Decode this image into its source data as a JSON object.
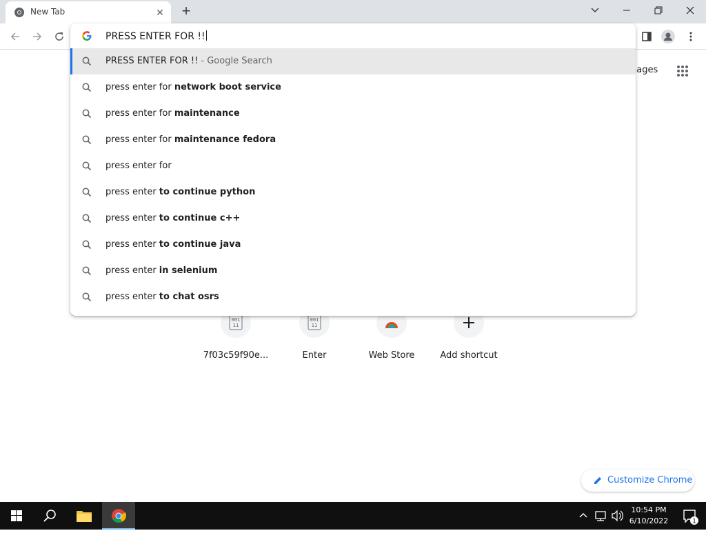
{
  "window": {
    "tab_title": "New Tab",
    "tab_close": "✕",
    "new_tab": "+"
  },
  "omnibox": {
    "input_value": "PRESS ENTER FOR !!",
    "google_letter": "G",
    "suggestions": [
      {
        "normal": "PRESS ENTER FOR !!",
        "bold": "",
        "suffix": " - Google Search",
        "selected": true
      },
      {
        "normal": "press enter for ",
        "bold": "network boot service",
        "suffix": ""
      },
      {
        "normal": "press enter for ",
        "bold": "maintenance",
        "suffix": ""
      },
      {
        "normal": "press enter for ",
        "bold": "maintenance fedora",
        "suffix": ""
      },
      {
        "normal": "press enter for",
        "bold": "",
        "suffix": ""
      },
      {
        "normal": "press enter ",
        "bold": "to continue python",
        "suffix": ""
      },
      {
        "normal": "press enter ",
        "bold": "to continue c++",
        "suffix": ""
      },
      {
        "normal": "press enter ",
        "bold": "to continue java",
        "suffix": ""
      },
      {
        "normal": "press enter ",
        "bold": "in selenium",
        "suffix": ""
      },
      {
        "normal": "press enter ",
        "bold": "to chat osrs",
        "suffix": ""
      }
    ]
  },
  "page": {
    "images_link": "nages",
    "shortcuts": [
      {
        "label": "7f03c59f90e...",
        "icon": "binary-file-icon"
      },
      {
        "label": "Enter",
        "icon": "binary-file-icon"
      },
      {
        "label": "Web Store",
        "icon": "chrome-webstore-icon"
      },
      {
        "label": "Add shortcut",
        "icon": "plus-icon"
      }
    ],
    "customize_label": "Customize Chrome"
  },
  "taskbar": {
    "time": "10:54 PM",
    "date": "6/10/2022",
    "notification_count": "1"
  },
  "colors": {
    "accent": "#1a73e8",
    "tabstrip": "#dee1e6",
    "taskbar": "#101010"
  }
}
